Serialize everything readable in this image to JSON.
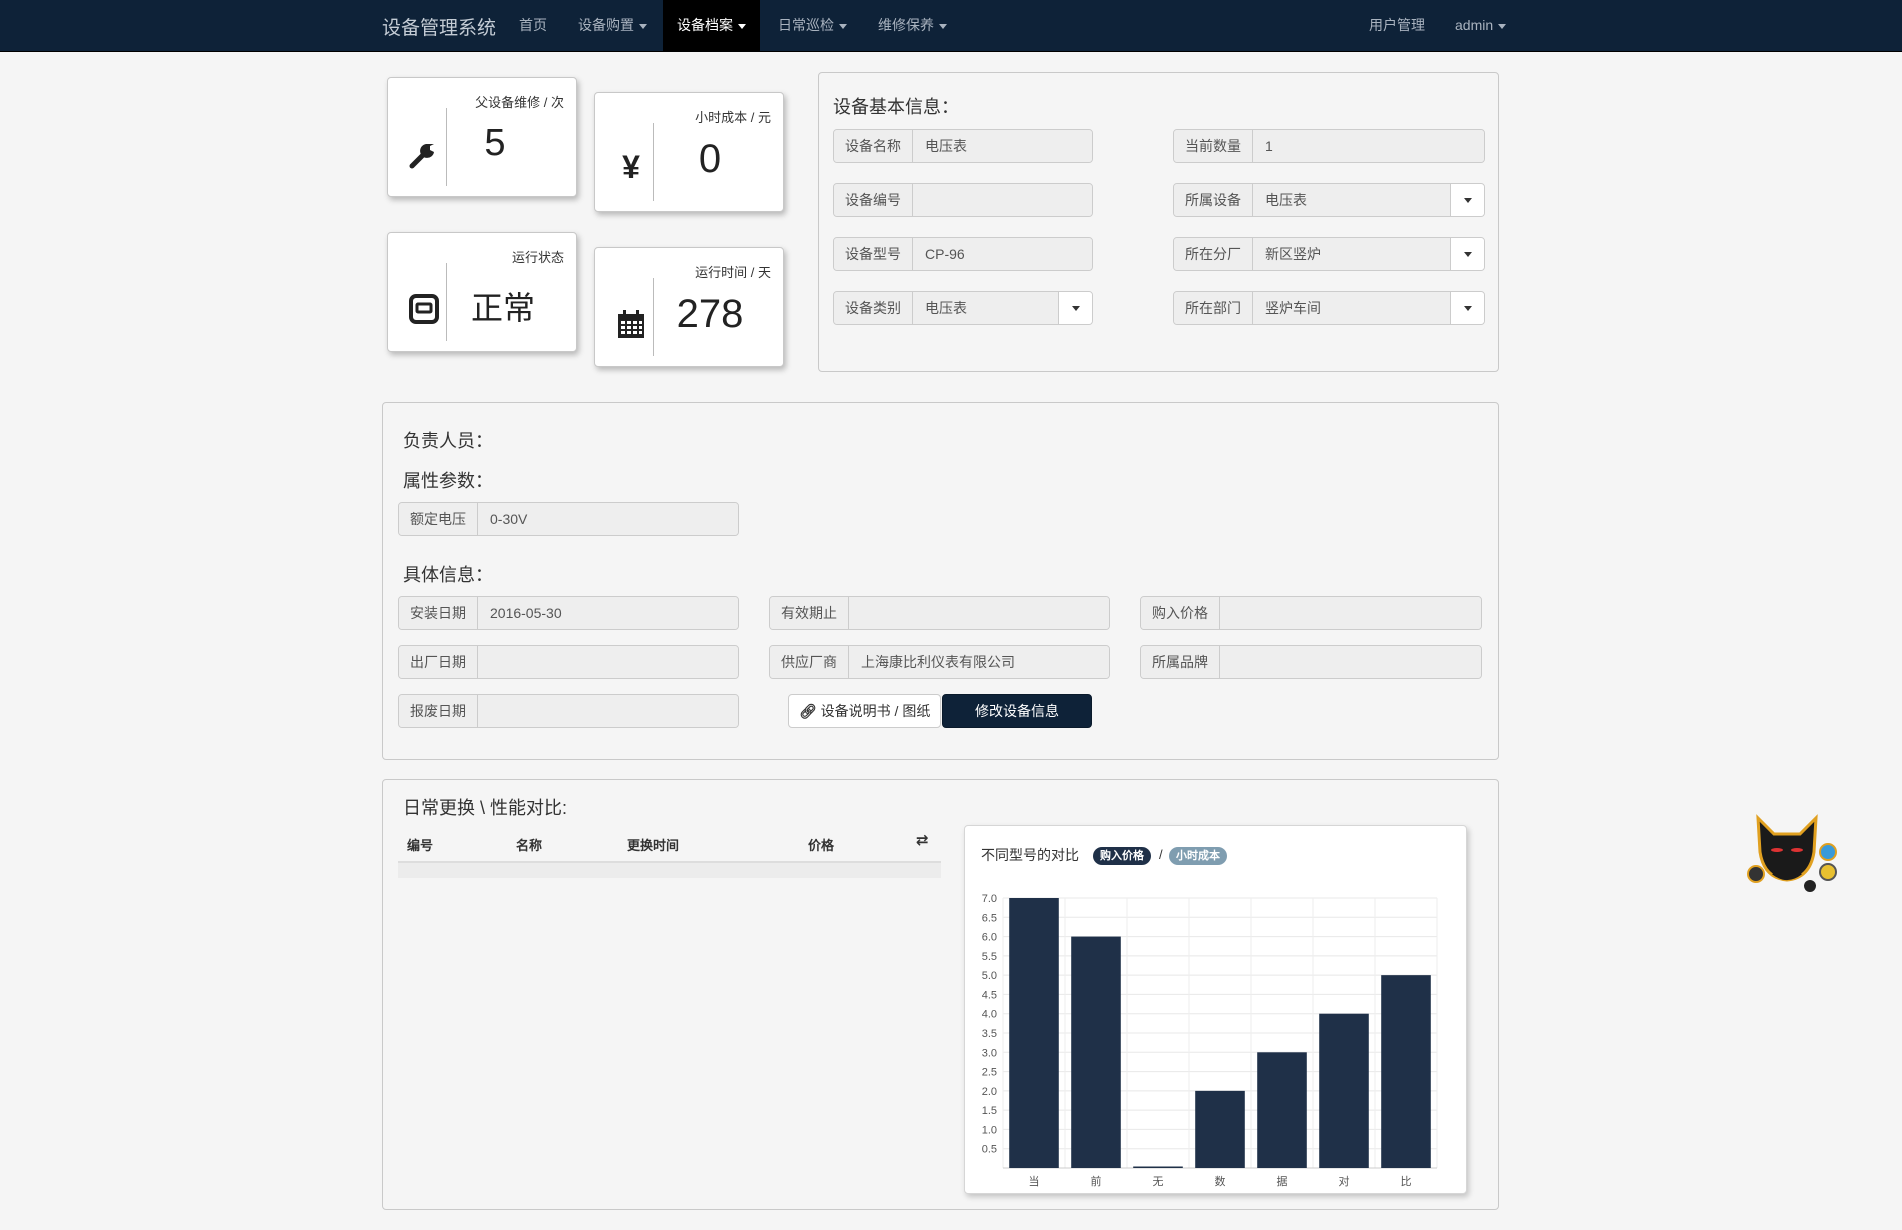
{
  "colors": {
    "navbar": "#0e2238",
    "bar": "#1f3048",
    "badge_price": "#1f3048",
    "badge_cost": "#7f9db0"
  },
  "navbar": {
    "brand": "设备管理系统",
    "items": [
      {
        "label": "首页"
      },
      {
        "label": "设备购置"
      },
      {
        "label": "设备档案"
      },
      {
        "label": "日常巡检"
      },
      {
        "label": "维修保养"
      }
    ],
    "user_mgmt": "用户管理",
    "user": "admin"
  },
  "stats": {
    "parent_repair": {
      "label": "父设备维修 / 次",
      "value": "5",
      "icon": "wrench-icon"
    },
    "hourly_cost": {
      "label": "小时成本 / 元",
      "value": "0",
      "icon": "yen-icon"
    },
    "run_status": {
      "label": "运行状态",
      "value": "正常",
      "icon": "status-icon"
    },
    "run_time": {
      "label": "运行时间 / 天",
      "value": "278",
      "icon": "calendar-icon"
    }
  },
  "basic_info": {
    "title": "设备基本信息：",
    "device_name": {
      "label": "设备名称",
      "value": "电压表"
    },
    "device_no": {
      "label": "设备编号",
      "value": ""
    },
    "device_model": {
      "label": "设备型号",
      "value": "CP-96"
    },
    "device_type": {
      "label": "设备类别",
      "value": "电压表"
    },
    "quantity": {
      "label": "当前数量",
      "value": "1"
    },
    "parent_device": {
      "label": "所属设备",
      "value": "电压表"
    },
    "factory": {
      "label": "所在分厂",
      "value": "新区竖炉"
    },
    "department": {
      "label": "所在部门",
      "value": "竖炉车间"
    }
  },
  "details": {
    "responsible_title": "负责人员：",
    "attributes_title": "属性参数：",
    "rated_voltage": {
      "label": "额定电压",
      "value": "0-30V"
    },
    "specific_title": "具体信息：",
    "install_date": {
      "label": "安装日期",
      "value": "2016-05-30"
    },
    "valid_until": {
      "label": "有效期止",
      "value": ""
    },
    "purchase_price": {
      "label": "购入价格",
      "value": ""
    },
    "manufacture_date": {
      "label": "出厂日期",
      "value": ""
    },
    "supplier": {
      "label": "供应厂商",
      "value": "上海康比利仪表有限公司"
    },
    "brand": {
      "label": "所属品牌",
      "value": ""
    },
    "scrap_date": {
      "label": "报废日期",
      "value": ""
    },
    "manual_button": "设备说明书 / 图纸",
    "edit_button": "修改设备信息"
  },
  "replacement": {
    "title": "日常更换 \\ 性能对比:",
    "columns": [
      "编号",
      "名称",
      "更换时间",
      "价格"
    ]
  },
  "chart": {
    "title": "不同型号的对比",
    "badge_price": "购入价格",
    "separator": "/",
    "badge_cost": "小时成本"
  },
  "chart_data": {
    "type": "bar",
    "categories": [
      "当",
      "前",
      "无",
      "数",
      "据",
      "对",
      "比"
    ],
    "values": [
      7.0,
      6.0,
      0.0,
      2.0,
      3.0,
      4.0,
      5.0
    ],
    "yticks": [
      "0.5",
      "1.0",
      "1.5",
      "2.0",
      "2.5",
      "3.0",
      "3.5",
      "4.0",
      "4.5",
      "5.0",
      "5.5",
      "6.0",
      "6.5",
      "7.0"
    ],
    "ylim": [
      0,
      7.0
    ],
    "grid": true
  }
}
